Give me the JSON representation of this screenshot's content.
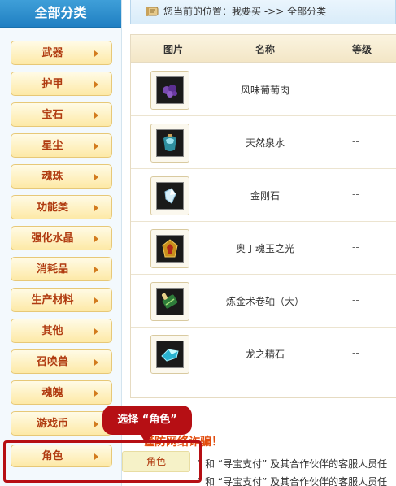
{
  "sidebar": {
    "title": "全部分类",
    "items": [
      {
        "label": "武器"
      },
      {
        "label": "护甲"
      },
      {
        "label": "宝石"
      },
      {
        "label": "星尘"
      },
      {
        "label": "魂珠"
      },
      {
        "label": "功能类"
      },
      {
        "label": "强化水晶"
      },
      {
        "label": "消耗品"
      },
      {
        "label": "生产材料"
      },
      {
        "label": "其他"
      },
      {
        "label": "召唤兽"
      },
      {
        "label": "魂魄"
      },
      {
        "label": "游戏币"
      }
    ],
    "selected": {
      "label": "角色"
    }
  },
  "breadcrumb": {
    "text": "您当前的位置：我要买 ->> 全部分类"
  },
  "table": {
    "headers": {
      "image": "图片",
      "name": "名称",
      "grade": "等级"
    },
    "rows": [
      {
        "name": "风味葡萄肉",
        "grade": "--",
        "icon": "grape-meat-icon",
        "color": "#6a3fa0"
      },
      {
        "name": "天然泉水",
        "grade": "--",
        "icon": "spring-water-icon",
        "color": "#3aa6b0"
      },
      {
        "name": "金刚石",
        "grade": "--",
        "icon": "diamond-icon",
        "color": "#bfe3f5"
      },
      {
        "name": "奥丁魂玉之光",
        "grade": "--",
        "icon": "soul-jade-icon",
        "color": "#d8a020"
      },
      {
        "name": "炼金术卷轴（大）",
        "grade": "--",
        "icon": "scroll-icon",
        "color": "#3f8f3a"
      },
      {
        "name": "龙之精石",
        "grade": "--",
        "icon": "dragon-stone-icon",
        "color": "#3fc2d8"
      }
    ]
  },
  "notice": {
    "title": "谨防网络诈骗！",
    "line1": "” 和 “寻宝支付” 及其合作伙伴的客服人员任",
    "line2": "” 和 “寻宝支付” 及其合作伙伴的客服人员任"
  },
  "callout": {
    "text": "选择 “角色”"
  },
  "submenu": {
    "label": "角色"
  },
  "colors": {
    "accent": "#b60f14",
    "sidebar_title_bg": "#2a8fd0",
    "button_text": "#b03b10"
  }
}
